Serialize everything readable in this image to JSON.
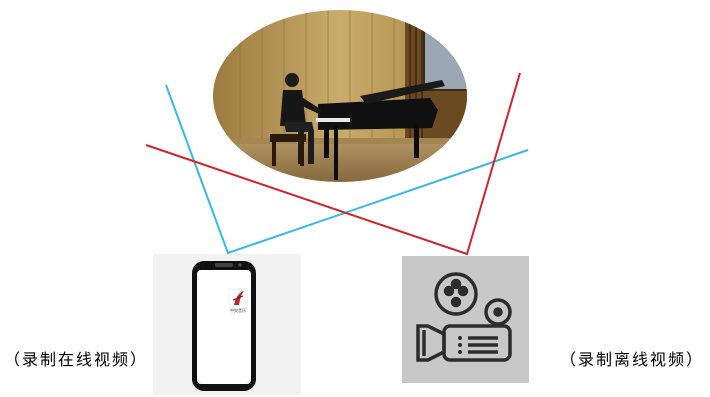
{
  "captions": {
    "online": "（录制在线视频）",
    "offline": "（录制离线视频）"
  },
  "phone_app_label": "中央音乐",
  "colors": {
    "blue_line": "#35b9e6",
    "red_line": "#d2232a",
    "camera_panel": "#c8c8c8",
    "camera_icon": "#2c2c2c",
    "phone_panel": "#f2f2f2",
    "phone_body": "#111111"
  },
  "icons": [
    "piano-performance-photo",
    "smartphone-icon",
    "app-logo-icon",
    "film-camera-icon"
  ]
}
